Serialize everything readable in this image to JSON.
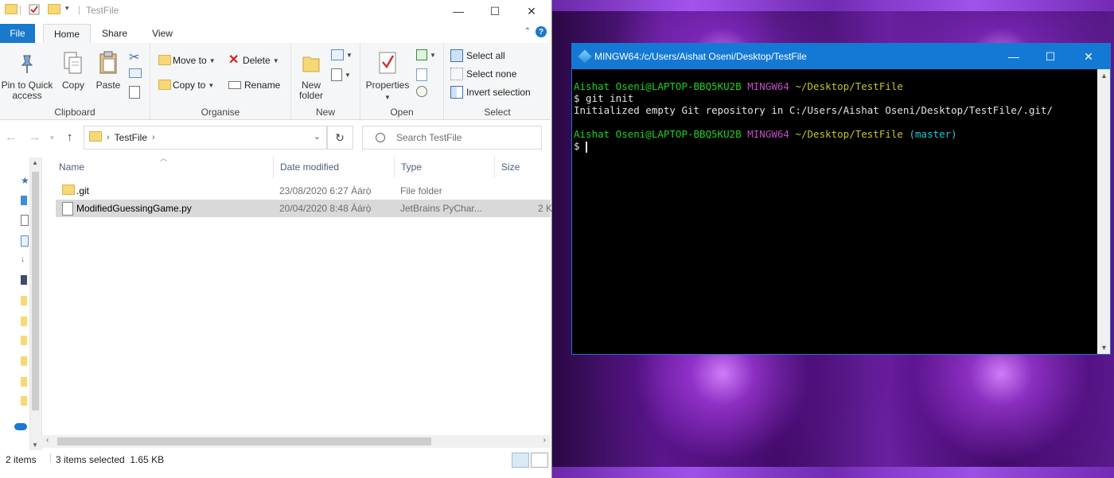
{
  "explorer": {
    "window_title": "TestFile",
    "tabs": [
      {
        "label": "File"
      },
      {
        "label": "Home"
      },
      {
        "label": "Share"
      },
      {
        "label": "View"
      }
    ],
    "ribbon": {
      "clipboard": {
        "label": "Clipboard",
        "pin": "Pin to Quick access",
        "copy": "Copy",
        "paste": "Paste"
      },
      "organise": {
        "label": "Organise",
        "move_to": "Move to",
        "copy_to": "Copy to",
        "delete": "Delete",
        "rename": "Rename"
      },
      "new": {
        "label": "New",
        "new_folder": "New folder"
      },
      "open": {
        "label": "Open",
        "properties": "Properties"
      },
      "select": {
        "label": "Select",
        "select_all": "Select all",
        "select_none": "Select none",
        "invert_selection": "Invert selection"
      }
    },
    "address": {
      "crumb": "TestFile",
      "search_placeholder": "Search TestFile"
    },
    "columns": {
      "name": "Name",
      "date_modified": "Date modified",
      "type": "Type",
      "size": "Size"
    },
    "files": [
      {
        "name": ".git",
        "date": "23/08/2020 6:27 Àárọ̀",
        "type": "File folder",
        "size": "",
        "selected": false
      },
      {
        "name": "ModifiedGuessingGame.py",
        "date": "20/04/2020 8:48 Àárọ̀",
        "type": "JetBrains PyChar...",
        "size": "2 K",
        "selected": true
      }
    ],
    "status": {
      "item_count": "2 items",
      "selection": "3 items selected  1.65 KB"
    }
  },
  "terminal": {
    "title": "MINGW64:/c/Users/Aishat Oseni/Desktop/TestFile",
    "prompt1": {
      "user": "Aishat Oseni@LAPTOP-BBQ5KU2B",
      "env": "MINGW64",
      "path": "~/Desktop/TestFile"
    },
    "command": "$ git init",
    "output": "Initialized empty Git repository in C:/Users/Aishat Oseni/Desktop/TestFile/.git/",
    "prompt2": {
      "user": "Aishat Oseni@LAPTOP-BBQ5KU2B",
      "env": "MINGW64",
      "path": "~/Desktop/TestFile",
      "branch": "(master)"
    },
    "prompt_symbol": "$"
  },
  "colors": {
    "ribbon_blue": "#1979ca",
    "terminal_title": "#1479d4",
    "git_user_green": "#1fd31f",
    "git_env_magenta": "#c050c0",
    "git_path_yellow": "#c7c42c",
    "git_branch_cyan": "#1ec8d3"
  }
}
